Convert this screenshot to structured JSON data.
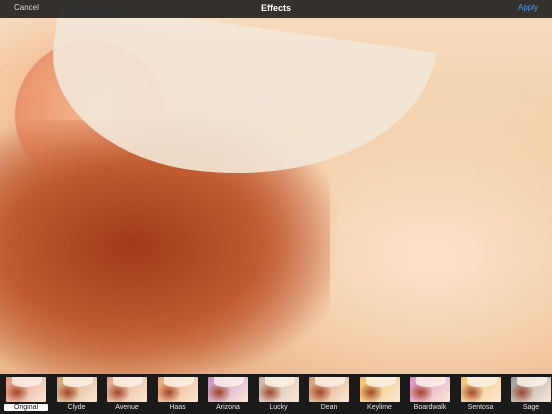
{
  "topbar": {
    "cancel_label": "Cancel",
    "title": "Effects",
    "apply_label": "Apply",
    "apply_color": "#3f9ff0"
  },
  "effects": [
    {
      "label": "Original",
      "selected": true,
      "tint": "#e4937a"
    },
    {
      "label": "Clyde",
      "selected": false,
      "tint": "#d4a271"
    },
    {
      "label": "Avenue",
      "selected": false,
      "tint": "#e2a183"
    },
    {
      "label": "Haas",
      "selected": false,
      "tint": "#eba36c"
    },
    {
      "label": "Arizona",
      "selected": false,
      "tint": "#c68fc4"
    },
    {
      "label": "Lucky",
      "selected": false,
      "tint": "#c7b3a4"
    },
    {
      "label": "Dean",
      "selected": false,
      "tint": "#d79a6f"
    },
    {
      "label": "Keylime",
      "selected": false,
      "tint": "#f1c160"
    },
    {
      "label": "Boardwalk",
      "selected": false,
      "tint": "#e08dc3"
    },
    {
      "label": "Sentosa",
      "selected": false,
      "tint": "#f0c36e"
    },
    {
      "label": "Sage",
      "selected": false,
      "tint": "#9d9d9d"
    }
  ]
}
